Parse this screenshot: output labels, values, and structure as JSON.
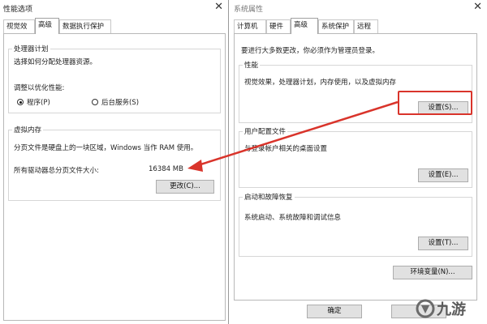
{
  "left": {
    "title": "性能选项",
    "tabs": [
      "视觉效果",
      "高级",
      "数据执行保护"
    ],
    "processor": {
      "label": "处理器计划",
      "desc": "选择如何分配处理器资源。",
      "optimize_label": "调整以优化性能:",
      "option_programs": "程序(P)",
      "option_background": "后台服务(S)"
    },
    "virtual_memory": {
      "label": "虚拟内存",
      "desc": "分页文件是硬盘上的一块区域，Windows 当作 RAM 使用。",
      "total_label": "所有驱动器总分页文件大小:",
      "total_value": "16384 MB",
      "change_button": "更改(C)..."
    }
  },
  "right": {
    "title": "系统属性",
    "tabs": [
      "计算机名",
      "硬件",
      "高级",
      "系统保护",
      "远程"
    ],
    "admin_note": "要进行大多数更改，你必须作为管理员登录。",
    "performance": {
      "label": "性能",
      "desc": "视觉效果，处理器计划，内存使用，以及虚拟内存",
      "button": "设置(S)..."
    },
    "user_profiles": {
      "label": "用户配置文件",
      "desc": "与登录帐户相关的桌面设置",
      "button": "设置(E)..."
    },
    "startup": {
      "label": "启动和故障恢复",
      "desc": "系统启动、系统故障和调试信息",
      "button": "设置(T)..."
    },
    "env_button": "环境变量(N)...",
    "ok_button": "确定",
    "watermark": "九游"
  },
  "colors": {
    "accent_red": "#d9342b"
  }
}
